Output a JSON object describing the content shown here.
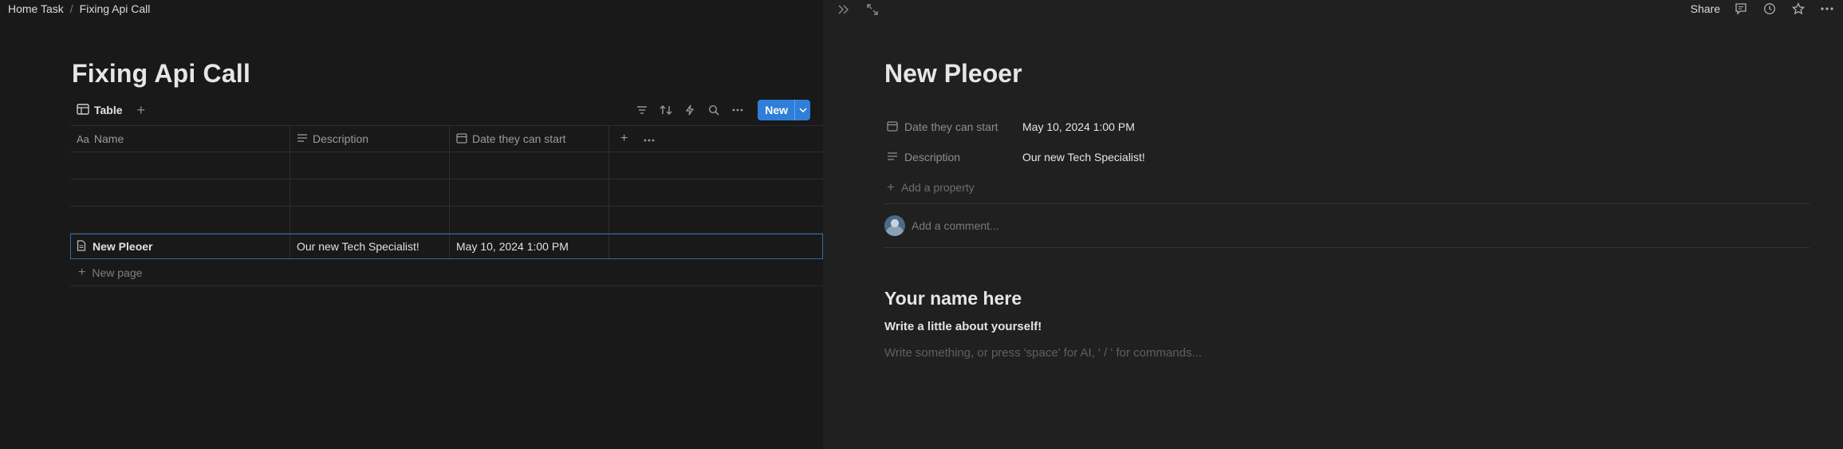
{
  "breadcrumb": {
    "items": [
      "Home Task",
      "Fixing Api Call"
    ],
    "separator": "/"
  },
  "database": {
    "title": "Fixing Api Call",
    "view_tab": "Table",
    "new_button": "New",
    "columns": [
      {
        "prefix": "Aa",
        "label": "Name"
      },
      {
        "label": "Description"
      },
      {
        "label": "Date they can start"
      }
    ],
    "rows": [
      {
        "name": "New Pleoer",
        "description": "Our new Tech Specialist!",
        "date": "May 10, 2024 1:00 PM"
      }
    ],
    "new_page": "New page"
  },
  "page": {
    "share": "Share",
    "title": "New Pleoer",
    "properties": [
      {
        "name": "Date they can start",
        "value": "May 10, 2024 1:00 PM"
      },
      {
        "name": "Description",
        "value": "Our new Tech Specialist!"
      }
    ],
    "add_property": "Add a property",
    "comment_placeholder": "Add a comment...",
    "heading": "Your name here",
    "body": "Write a little about yourself!",
    "placeholder": "Write something, or press 'space' for AI, ' / ' for commands..."
  },
  "colors": {
    "accent": "#2f7ed8",
    "background": "#191919",
    "panel": "#202020"
  }
}
